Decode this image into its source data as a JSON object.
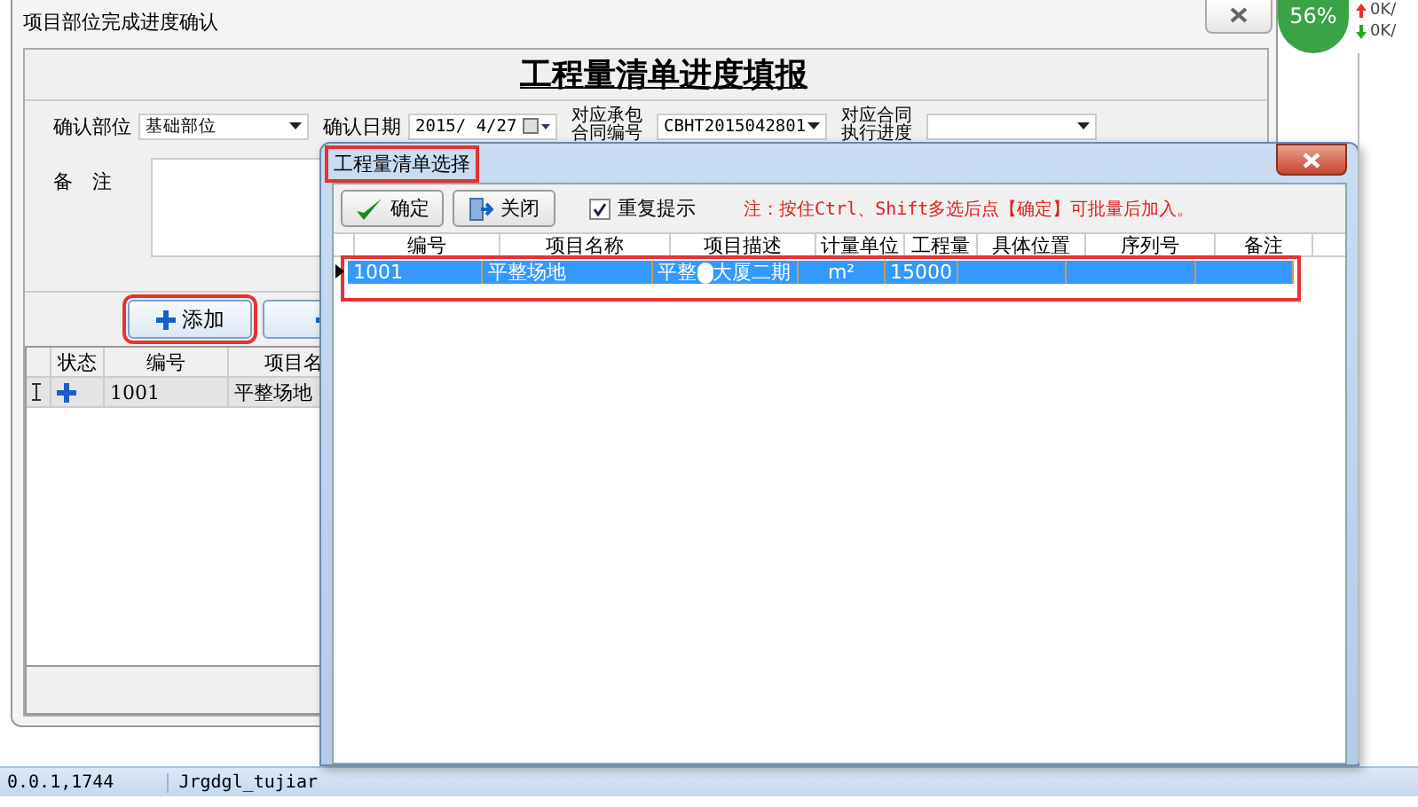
{
  "main_window": {
    "title": "项目部位完成进度确认",
    "heading": "工程量清单进度填报",
    "fields": [
      {
        "label": "确认部位",
        "value": "基础部位",
        "kind": "dropdown"
      },
      {
        "label": "确认日期",
        "value": "2015/ 4/27",
        "kind": "date"
      },
      {
        "label": "对应承包合同编号",
        "value": "CBHT2015042801",
        "kind": "dropdown"
      },
      {
        "label": "对应合同执行进度",
        "kind": "dropdown"
      }
    ],
    "remarks": {
      "label": "备　注"
    },
    "buttons": [
      {
        "label": "添加",
        "kind": "add",
        "highlighted": true
      },
      {
        "kind": "remove",
        "highlighted": false
      }
    ],
    "grid": {
      "columns": [
        "状态",
        "编号",
        "项目名"
      ],
      "rows": [
        {
          "added": true,
          "code": "1001",
          "name": "平整场地"
        }
      ]
    }
  },
  "dialog": {
    "title": "工程量清单选择",
    "title_highlighted": true,
    "buttons": [
      {
        "label": "确定",
        "kind": "ok"
      },
      {
        "label": "关闭",
        "kind": "close"
      }
    ],
    "repeat_prompt": {
      "label": "重复提示",
      "checked": true
    },
    "note": "注：按住Ctrl、Shift多选后点【确定】可批量后加入。",
    "grid": {
      "columns": [
        "编号",
        "项目名称",
        "项目描述",
        "计量单位",
        "工程量",
        "具体位置",
        "序列号",
        "备注"
      ],
      "rows": [
        {
          "selected": true,
          "highlighted": true,
          "code": "1001",
          "name": "平整场地",
          "description_parts": [
            "平整",
            "大厦二期"
          ],
          "unit": "m²",
          "quantity": "15000"
        }
      ]
    }
  },
  "status_bar": [
    "0.0.1,1744",
    "Jrgdgl_tujiar"
  ],
  "tray": {
    "percent": "56%",
    "rates": [
      "0K/",
      "0K/"
    ]
  }
}
